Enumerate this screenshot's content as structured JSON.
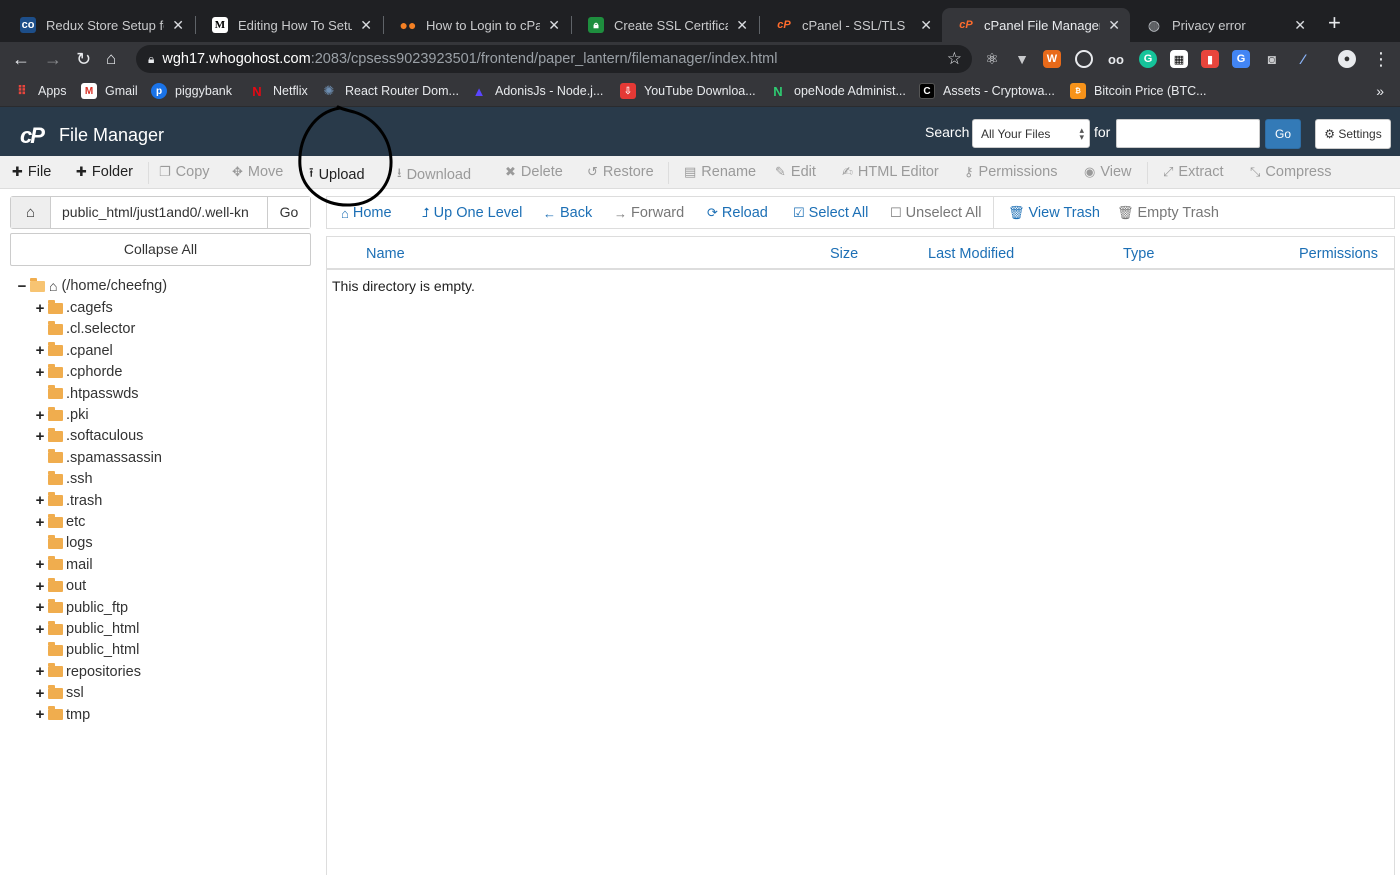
{
  "browser": {
    "tabs": [
      {
        "label": "Redux Store Setup for",
        "icon": "codesandbox-icon",
        "active": false
      },
      {
        "label": "Editing How To Setup",
        "icon": "medium-icon",
        "active": false
      },
      {
        "label": "How to Login to cPane",
        "icon": "dots-icon",
        "active": false
      },
      {
        "label": "Create SSL Certificate",
        "icon": "lock-icon",
        "active": false
      },
      {
        "label": "cPanel - SSL/TLS",
        "icon": "cpanel-icon",
        "active": false
      },
      {
        "label": "cPanel File Manager v",
        "icon": "cpanel-icon",
        "active": true
      },
      {
        "label": "Privacy error",
        "icon": "globe-icon",
        "active": false
      }
    ],
    "url_host": "wgh17.whogohost.com",
    "url_path": ":2083/cpsess9023923501/frontend/paper_lantern/filemanager/index.html",
    "bookmarks": [
      {
        "label": "Apps",
        "icon": "apps-grid-icon",
        "color": "#e8453c"
      },
      {
        "label": "Gmail",
        "icon": "gmail-icon",
        "color": "#d93025"
      },
      {
        "label": "piggybank",
        "icon": "piggybank-icon",
        "color": "#1a73e8"
      },
      {
        "label": "Netflix",
        "icon": "netflix-icon",
        "color": "#e50914"
      },
      {
        "label": "React Router Dom...",
        "icon": "react-router-icon",
        "color": "#6e8fb3"
      },
      {
        "label": "AdonisJs - Node.j...",
        "icon": "adonis-icon",
        "color": "#5a45ff"
      },
      {
        "label": "YouTube Downloa...",
        "icon": "download-icon",
        "color": "#e53935"
      },
      {
        "label": "opeNode Administ...",
        "icon": "opennode-icon",
        "color": "#2ecc71"
      },
      {
        "label": "Assets - Cryptowa...",
        "icon": "cryptowatch-icon",
        "color": "#000000"
      },
      {
        "label": "Bitcoin Price (BTC...",
        "icon": "bitcoin-icon",
        "color": "#f7931a"
      }
    ]
  },
  "cpanel": {
    "logo": "cP",
    "title": "File Manager",
    "search_label": "Search",
    "search_scope": "All Your Files",
    "for_label": "for",
    "search_value": "",
    "go_label": "Go",
    "settings_label": "Settings"
  },
  "toolbar": [
    {
      "label": "File",
      "enabled": true,
      "icon": "plus-icon"
    },
    {
      "label": "Folder",
      "enabled": true,
      "icon": "plus-icon"
    },
    {
      "label": "Copy",
      "enabled": false,
      "icon": "copy-icon"
    },
    {
      "label": "Move",
      "enabled": false,
      "icon": "move-icon"
    },
    {
      "label": "Upload",
      "enabled": true,
      "icon": "upload-icon"
    },
    {
      "label": "Download",
      "enabled": false,
      "icon": "download-icon"
    },
    {
      "label": "Delete",
      "enabled": false,
      "icon": "delete-icon"
    },
    {
      "label": "Restore",
      "enabled": false,
      "icon": "restore-icon"
    },
    {
      "label": "Rename",
      "enabled": false,
      "icon": "rename-icon"
    },
    {
      "label": "Edit",
      "enabled": false,
      "icon": "pencil-icon"
    },
    {
      "label": "HTML Editor",
      "enabled": false,
      "icon": "html-editor-icon"
    },
    {
      "label": "Permissions",
      "enabled": false,
      "icon": "key-icon"
    },
    {
      "label": "View",
      "enabled": false,
      "icon": "eye-icon"
    },
    {
      "label": "Extract",
      "enabled": false,
      "icon": "extract-icon"
    },
    {
      "label": "Compress",
      "enabled": false,
      "icon": "compress-icon"
    }
  ],
  "path": {
    "value": "public_html/just1and0/.well-kn",
    "go_label": "Go",
    "collapse_label": "Collapse All"
  },
  "tree": {
    "root": "(/home/cheefng)",
    "items": [
      {
        "label": ".cagefs",
        "expandable": true
      },
      {
        "label": ".cl.selector",
        "expandable": false
      },
      {
        "label": ".cpanel",
        "expandable": true
      },
      {
        "label": ".cphorde",
        "expandable": true
      },
      {
        "label": ".htpasswds",
        "expandable": false
      },
      {
        "label": ".pki",
        "expandable": true
      },
      {
        "label": ".softaculous",
        "expandable": true
      },
      {
        "label": ".spamassassin",
        "expandable": false
      },
      {
        "label": ".ssh",
        "expandable": false
      },
      {
        "label": ".trash",
        "expandable": true
      },
      {
        "label": "etc",
        "expandable": true
      },
      {
        "label": "logs",
        "expandable": false
      },
      {
        "label": "mail",
        "expandable": true
      },
      {
        "label": "out",
        "expandable": true
      },
      {
        "label": "public_ftp",
        "expandable": true
      },
      {
        "label": "public_html",
        "expandable": true
      },
      {
        "label": "public_html",
        "expandable": false
      },
      {
        "label": "repositories",
        "expandable": true
      },
      {
        "label": "ssl",
        "expandable": true
      },
      {
        "label": "tmp",
        "expandable": true
      }
    ]
  },
  "actions": [
    {
      "label": "Home",
      "enabled": true,
      "icon": "home-icon"
    },
    {
      "label": "Up One Level",
      "enabled": true,
      "icon": "level-up-icon"
    },
    {
      "label": "Back",
      "enabled": true,
      "icon": "arrow-left-icon"
    },
    {
      "label": "Forward",
      "enabled": false,
      "icon": "arrow-right-icon"
    },
    {
      "label": "Reload",
      "enabled": true,
      "icon": "reload-icon"
    },
    {
      "label": "Select All",
      "enabled": true,
      "icon": "checkbox-checked-icon"
    },
    {
      "label": "Unselect All",
      "enabled": false,
      "icon": "checkbox-empty-icon"
    },
    {
      "label": "View Trash",
      "enabled": true,
      "icon": "trash-icon"
    },
    {
      "label": "Empty Trash",
      "enabled": false,
      "icon": "trash-icon"
    }
  ],
  "table": {
    "columns": [
      "Name",
      "Size",
      "Last Modified",
      "Type",
      "Permissions"
    ],
    "empty_message": "This directory is empty."
  }
}
